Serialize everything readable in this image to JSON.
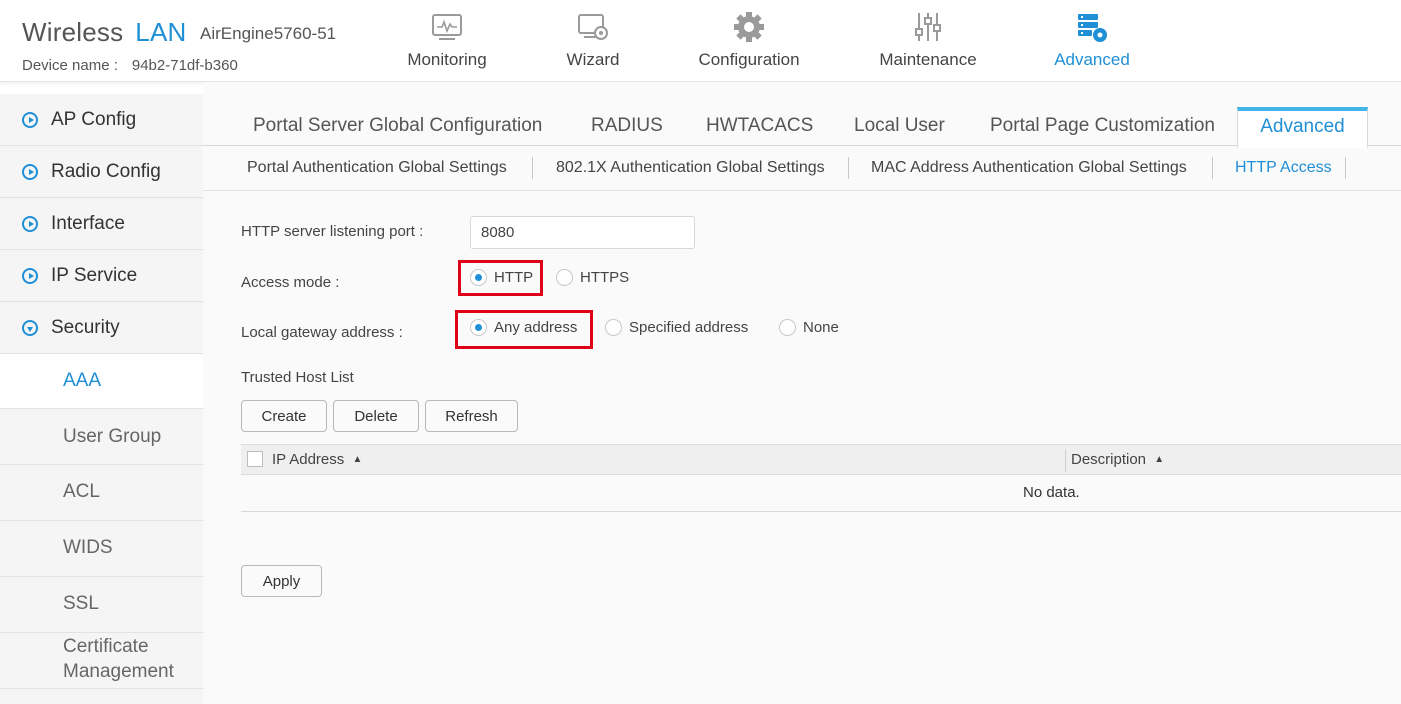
{
  "header": {
    "brand_word": "Wireless",
    "brand_lan": "LAN",
    "model": "AirEngine5760-51",
    "device_name_label": "Device name :",
    "device_name_value": "94b2-71df-b360",
    "nav": [
      {
        "label": "Monitoring",
        "icon": "monitor-icon"
      },
      {
        "label": "Wizard",
        "icon": "wizard-icon"
      },
      {
        "label": "Configuration",
        "icon": "gear-icon"
      },
      {
        "label": "Maintenance",
        "icon": "sliders-icon"
      },
      {
        "label": "Advanced",
        "icon": "advanced-settings-icon",
        "active": true
      }
    ]
  },
  "sidebar": {
    "items": [
      {
        "label": "AP Config"
      },
      {
        "label": "Radio Config"
      },
      {
        "label": "Interface"
      },
      {
        "label": "IP Service"
      },
      {
        "label": "Security",
        "expanded": true
      }
    ],
    "sub_items": [
      {
        "label": "AAA",
        "active": true
      },
      {
        "label": "User Group"
      },
      {
        "label": "ACL"
      },
      {
        "label": "WIDS"
      },
      {
        "label": "SSL"
      },
      {
        "label": "Certificate Management"
      }
    ]
  },
  "tabs": [
    {
      "label": "Portal Server Global Configuration"
    },
    {
      "label": "RADIUS"
    },
    {
      "label": "HWTACACS"
    },
    {
      "label": "Local User"
    },
    {
      "label": "Portal Page Customization"
    },
    {
      "label": "Advanced",
      "active": true
    }
  ],
  "subtabs": [
    {
      "label": "Portal Authentication Global Settings"
    },
    {
      "label": "802.1X Authentication Global Settings"
    },
    {
      "label": "MAC Address Authentication Global Settings"
    },
    {
      "label": "HTTP Access",
      "active": true
    }
  ],
  "form": {
    "port_label": "HTTP server listening port :",
    "port_value": "8080",
    "access_mode_label": "Access mode :",
    "access_modes": [
      {
        "label": "HTTP",
        "checked": true
      },
      {
        "label": "HTTPS",
        "checked": false
      }
    ],
    "gateway_label": "Local gateway address :",
    "gateway_options": [
      {
        "label": "Any address",
        "checked": true
      },
      {
        "label": "Specified address",
        "checked": false
      },
      {
        "label": "None",
        "checked": false
      }
    ],
    "trusted_host_title": "Trusted Host List",
    "buttons": {
      "create": "Create",
      "delete": "Delete",
      "refresh": "Refresh"
    },
    "table": {
      "columns": [
        "IP Address",
        "Description"
      ],
      "empty_text": "No data."
    },
    "apply_label": "Apply"
  },
  "colors": {
    "accent": "#1f8fd6",
    "highlight_box": "#e0001a",
    "active_tab_top": "#41b6e6"
  }
}
